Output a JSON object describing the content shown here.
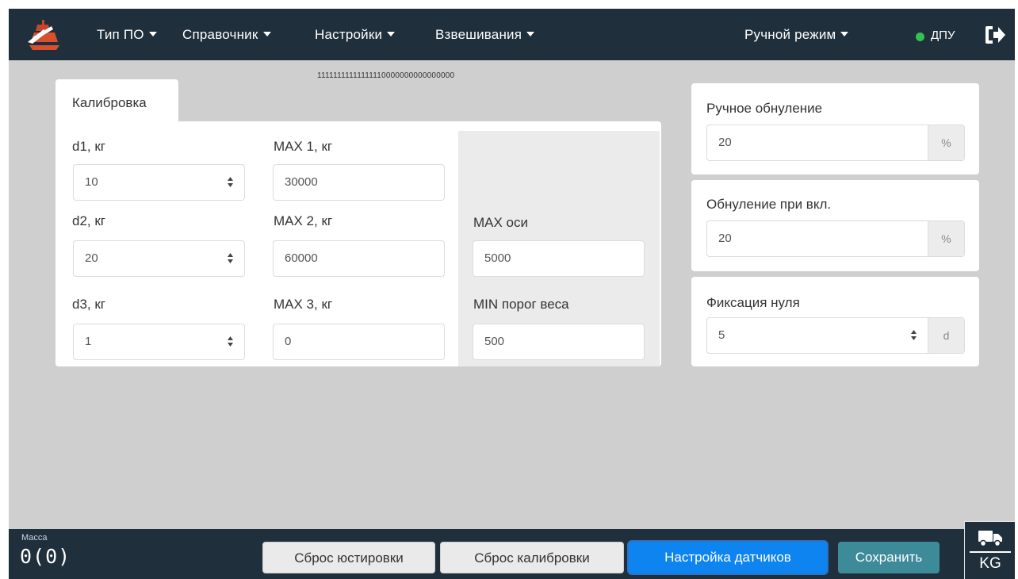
{
  "navbar": {
    "menu": [
      {
        "label": "Тип ПО",
        "icon": "caret-down-icon"
      },
      {
        "label": "Справочник",
        "icon": "caret-down-icon"
      },
      {
        "label": "Настройки",
        "icon": "caret-down-icon"
      },
      {
        "label": "Взвешивания",
        "icon": "caret-down-icon"
      }
    ],
    "mode": {
      "label": "Ручной режим",
      "icon": "caret-down-icon"
    },
    "status": {
      "label": "ДПУ",
      "color": "#33c24d"
    },
    "logout_icon": "logout-icon",
    "logo_icon": "scales-logo-icon"
  },
  "debug_bits": "11111111111111110000000000000000",
  "calibration": {
    "tab_label": "Калибровка",
    "d1": {
      "label": "d1, кг",
      "value": "10"
    },
    "d2": {
      "label": "d2, кг",
      "value": "20"
    },
    "d3": {
      "label": "d3, кг",
      "value": "1"
    },
    "max1": {
      "label": "MAX 1, кг",
      "value": "30000"
    },
    "max2": {
      "label": "MAX 2, кг",
      "value": "60000"
    },
    "max3": {
      "label": "MAX 3, кг",
      "value": "0"
    },
    "max_axis": {
      "label": "MAX оси",
      "value": "5000"
    },
    "min_weight": {
      "label": "MIN порог веса",
      "value": "500"
    }
  },
  "zeroing": {
    "manual": {
      "label": "Ручное обнуление",
      "value": "20",
      "unit": "%"
    },
    "on_power": {
      "label": "Обнуление при вкл.",
      "value": "20",
      "unit": "%"
    },
    "fix": {
      "label": "Фиксация нуля",
      "value": "5",
      "unit": "d"
    }
  },
  "bottombar": {
    "mass_label": "Масса",
    "mass_value": "0(0)",
    "buttons": {
      "reset_adjust": "Сброс юстировки",
      "reset_calib": "Сброс калибровки",
      "sensors": "Настройка датчиков",
      "save": "Сохранить"
    },
    "unit": "KG",
    "truck_icon": "truck-icon"
  },
  "colors": {
    "navbar": "#1f2f3b",
    "background": "#cfcfcf",
    "primary": "#0d84f0",
    "teal": "#3d8b99",
    "status_online": "#33c24d"
  }
}
